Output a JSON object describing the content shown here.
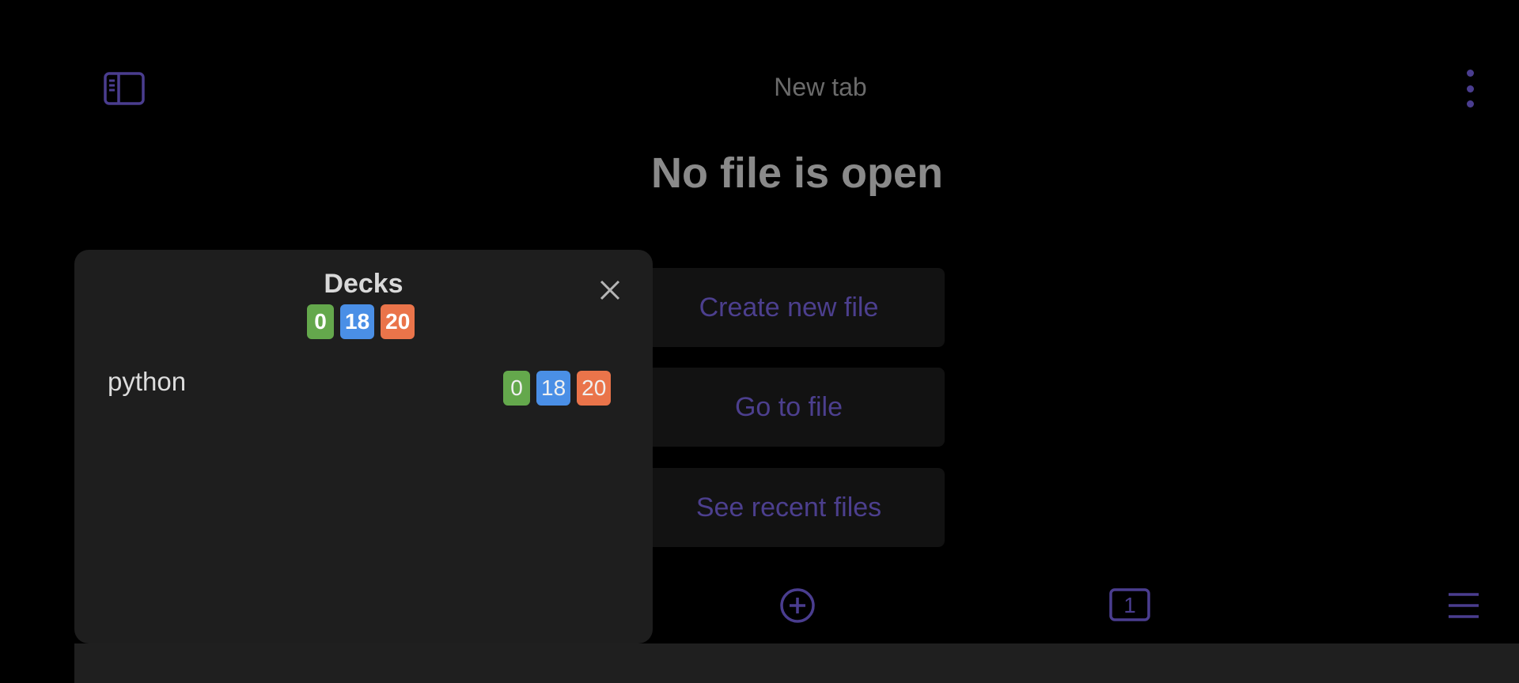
{
  "header": {
    "tab_title": "New tab",
    "sidebar_toggle_icon": "sidebar-icon",
    "more_icon": "vertical-dots-icon"
  },
  "main": {
    "empty_title": "No file is open",
    "actions": [
      {
        "label": "Create new file"
      },
      {
        "label": "Go to file"
      },
      {
        "label": "See recent files"
      }
    ]
  },
  "bottom_nav": {
    "new_tab_icon": "plus-circle-icon",
    "tab_count": "1",
    "menu_icon": "hamburger-icon"
  },
  "decks_modal": {
    "title": "Decks",
    "close_icon": "close-icon",
    "totals": {
      "new": "0",
      "learning": "18",
      "due": "20"
    },
    "decks": [
      {
        "name": "python",
        "new": "0",
        "learning": "18",
        "due": "20"
      }
    ]
  },
  "colors": {
    "accent": "#4c3f8e",
    "new_badge": "#64a84c",
    "learning_badge": "#4a8fe6",
    "due_badge": "#ea744a",
    "modal_bg": "#1e1e1e"
  }
}
